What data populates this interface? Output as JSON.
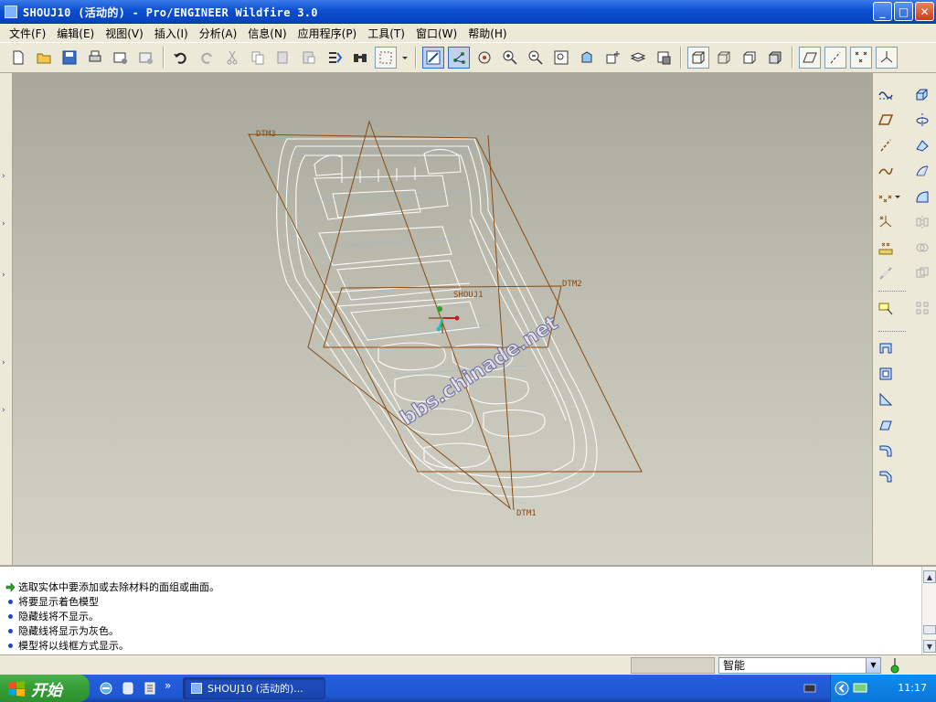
{
  "window": {
    "title": "SHOUJ10 (活动的) - Pro/ENGINEER Wildfire 3.0",
    "min_label": "_",
    "max_label": "□",
    "close_label": "✕"
  },
  "menu": [
    {
      "label": "文件(F)"
    },
    {
      "label": "编辑(E)"
    },
    {
      "label": "视图(V)"
    },
    {
      "label": "插入(I)"
    },
    {
      "label": "分析(A)"
    },
    {
      "label": "信息(N)"
    },
    {
      "label": "应用程序(P)"
    },
    {
      "label": "工具(T)"
    },
    {
      "label": "窗口(W)"
    },
    {
      "label": "帮助(H)"
    }
  ],
  "viewport": {
    "datums": {
      "dtm1": "DTM1",
      "dtm2": "DTM2",
      "dtm3": "DTM3",
      "csys": "SHOUJ1"
    },
    "watermark": "bbs.chinade.net"
  },
  "messages": [
    "选取实体中要添加或去除材料的面组或曲面。",
    "将要显示着色模型",
    "隐藏线将不显示。",
    "隐藏线将显示为灰色。",
    "模型将以线框方式显示。"
  ],
  "status": {
    "filter_value": "智能"
  },
  "taskbar": {
    "start_label": "开始",
    "task_title": "SHOUJ10 (活动的)...",
    "more_label": "»",
    "clock": "11:17"
  },
  "colors": {
    "datum": "#8a4a10",
    "wireframe": "#ffffff",
    "viewport_top": "#a7a89b",
    "viewport_bottom": "#d3d2c7"
  }
}
